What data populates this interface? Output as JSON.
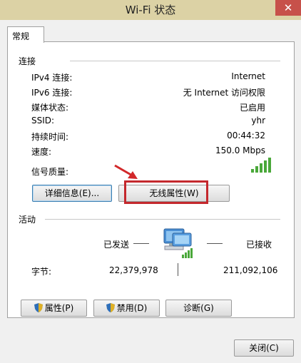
{
  "window": {
    "title": "Wi-Fi 状态"
  },
  "tab": {
    "label": "常规"
  },
  "connection": {
    "label": "连接",
    "rows": [
      {
        "label": "IPv4 连接:",
        "value": "Internet"
      },
      {
        "label": "IPv6 连接:",
        "value": "无 Internet 访问权限"
      },
      {
        "label": "媒体状态:",
        "value": "已启用"
      },
      {
        "label": "SSID:",
        "value": "yhr"
      },
      {
        "label": "持续时间:",
        "value": "00:44:32"
      },
      {
        "label": "速度:",
        "value": "150.0 Mbps"
      }
    ],
    "signal_label": "信号质量:",
    "signal_bars": 5,
    "signal_icon": "signal-bars-icon",
    "details_button": "详细信息(E)...",
    "wireless_properties_button": "无线属性(W)"
  },
  "activity": {
    "label": "活动",
    "sent_label": "已发送",
    "received_label": "已接收",
    "bytes_label": "字节:",
    "bytes_sent": "22,379,978",
    "bytes_received": "211,092,106",
    "network_icon": "network-computer-icon"
  },
  "buttons": {
    "properties": "属性(P)",
    "disable": "禁用(D)",
    "diagnose": "诊断(G)",
    "close": "关闭(C)"
  },
  "colors": {
    "highlight": "#c4282d",
    "arrow": "#d2282a",
    "signal": "#4aa83a"
  }
}
